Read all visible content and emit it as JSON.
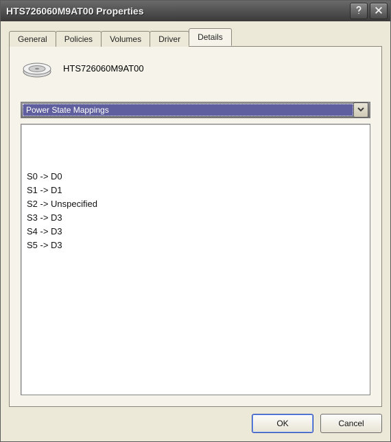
{
  "window": {
    "title": "HTS726060M9AT00 Properties"
  },
  "tabs": [
    {
      "label": "General"
    },
    {
      "label": "Policies"
    },
    {
      "label": "Volumes"
    },
    {
      "label": "Driver"
    },
    {
      "label": "Details"
    }
  ],
  "active_tab_index": 4,
  "device": {
    "name": "HTS726060M9AT00"
  },
  "details": {
    "property_selected": "Power State Mappings",
    "values": [
      "S0 -> D0",
      "S1 -> D1",
      "S2 -> Unspecified",
      "S3 -> D3",
      "S4 -> D3",
      "S5 -> D3"
    ]
  },
  "buttons": {
    "ok": "OK",
    "cancel": "Cancel"
  }
}
